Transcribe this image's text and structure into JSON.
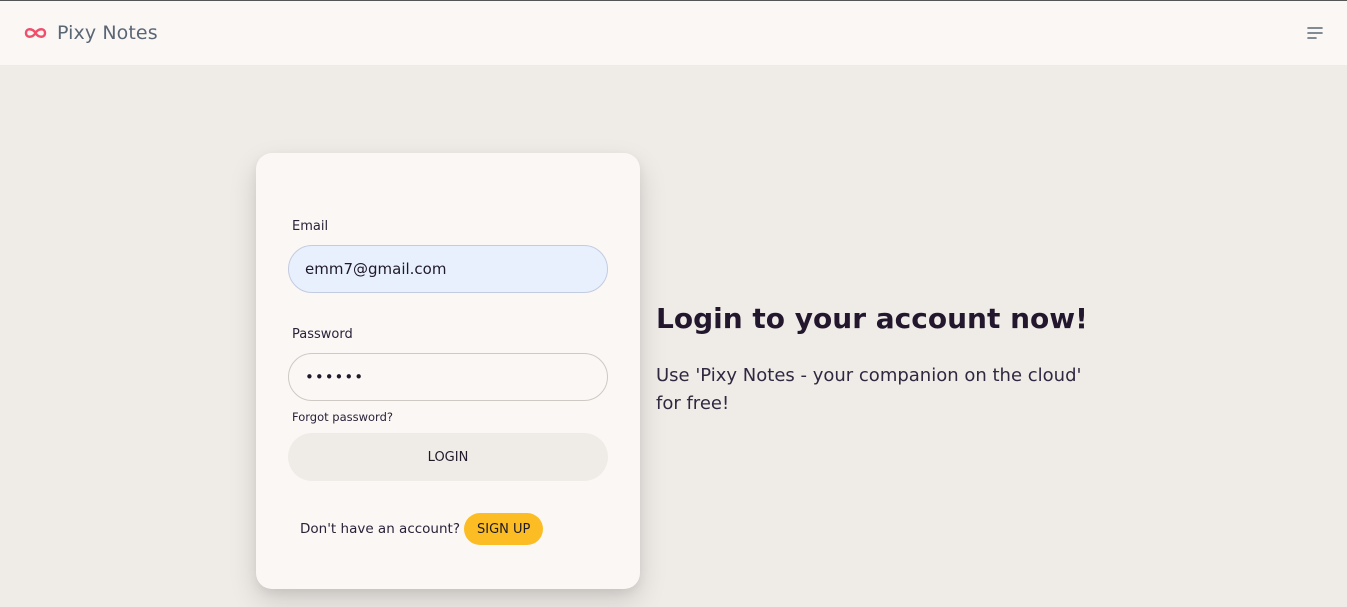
{
  "navbar": {
    "brand_name": "Pixy Notes",
    "brand_icon": "infinity-icon",
    "brand_color": "#f04e6b",
    "menu_icon": "menu-icon"
  },
  "login_form": {
    "email_label": "Email",
    "email_value": "emm7@gmail.com",
    "password_label": "Password",
    "password_value": "••••••",
    "forgot_password": "Forgot password?",
    "login_button": "LOGIN",
    "signup_prompt": "Don't have an account?",
    "signup_button": "SIGN UP",
    "signup_color": "#fbbd23"
  },
  "hero": {
    "title": "Login to your account now!",
    "text": "Use 'Pixy Notes - your companion on the cloud' for free!"
  }
}
